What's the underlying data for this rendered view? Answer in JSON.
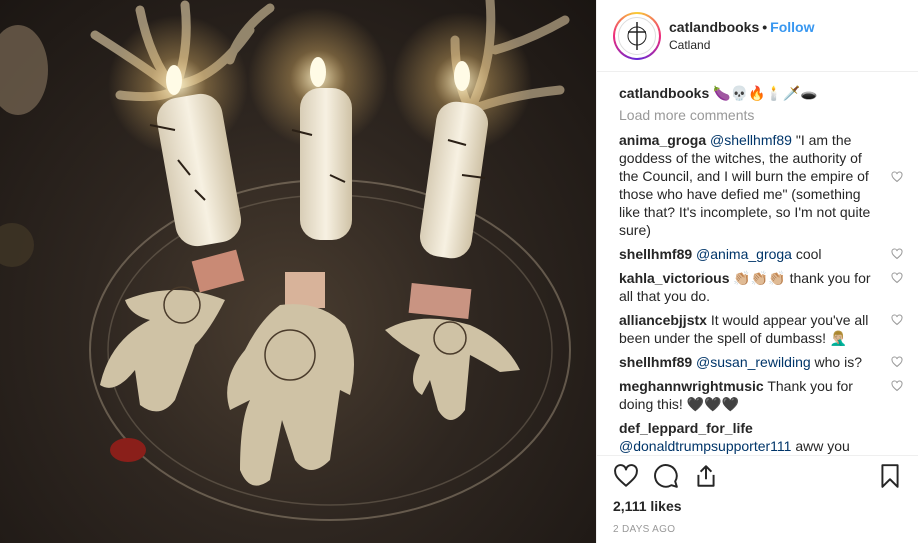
{
  "header": {
    "username": "catlandbooks",
    "separator": "•",
    "follow_label": "Follow",
    "location": "Catland"
  },
  "caption": {
    "username": "catlandbooks",
    "text": "🍆💀🔥🕯️🗡️🕳️"
  },
  "load_more_label": "Load more comments",
  "comments": [
    {
      "username": "anima_groga",
      "mention": "@shellhmf89",
      "text": "\"I am the goddess of the witches, the authority of the Council, and I will burn the empire of those who have defied me\" (something like that? It's incomplete, so I'm not quite sure)"
    },
    {
      "username": "shellhmf89",
      "mention": "@anima_groga",
      "text": "cool"
    },
    {
      "username": "kahla_victorious",
      "mention": "",
      "text": "👏🏼👏🏼👏🏼 thank you for all that you do."
    },
    {
      "username": "alliancebjjstx",
      "mention": "",
      "text": "It would appear you've all been under the spell of dumbass! 🤦🏼‍♂️"
    },
    {
      "username": "shellhmf89",
      "mention": "@susan_rewilding",
      "text": "who is?"
    },
    {
      "username": "meghannwrightmusic",
      "mention": "",
      "text": "Thank you for doing this! 🖤🖤🖤"
    },
    {
      "username": "def_leppard_for_life",
      "mention": "@donaldtrumpsupporter111",
      "text": "aww you think that childish"
    }
  ],
  "likes": "2,111 likes",
  "posted_ago": "2 DAYS AGO",
  "icons": {
    "like": "heart-icon",
    "comment": "comment-icon",
    "share": "share-icon",
    "save": "bookmark-icon"
  }
}
